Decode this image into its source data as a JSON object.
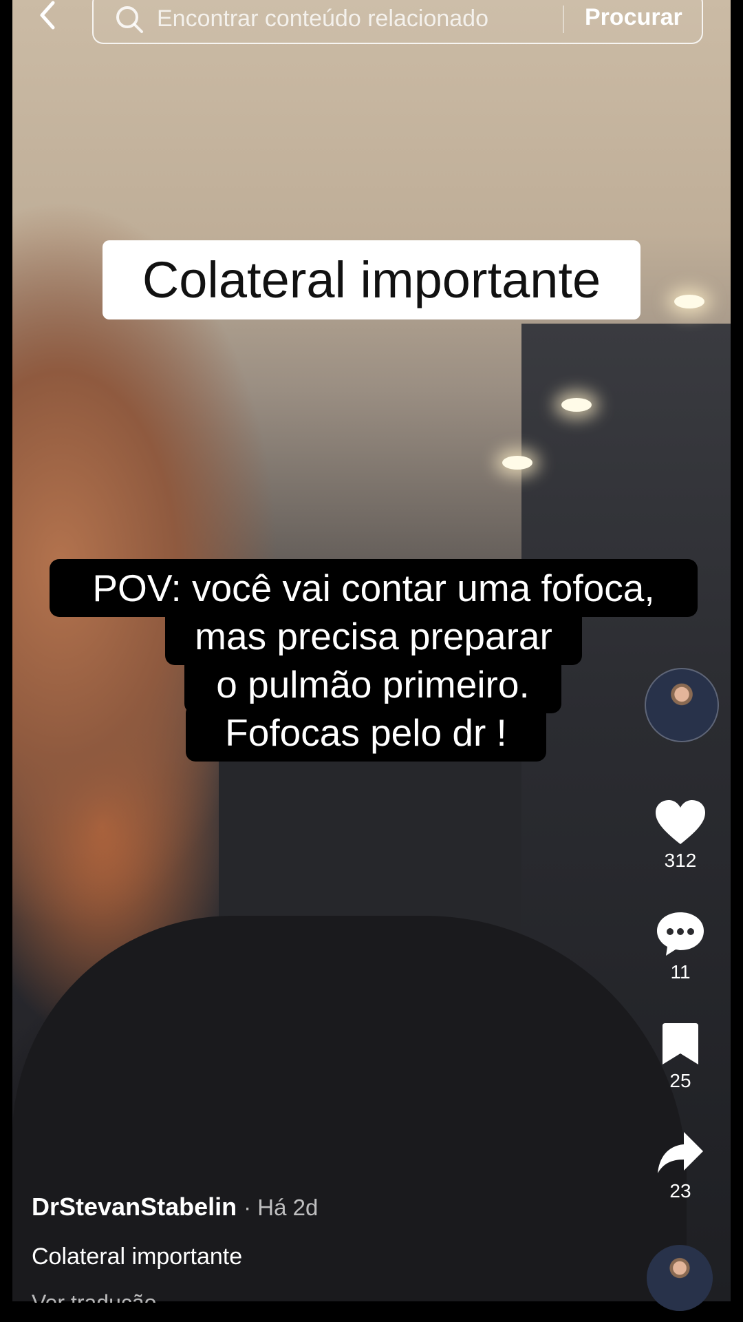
{
  "search": {
    "placeholder": "Encontrar conteúdo relacionado",
    "submit_label": "Procurar"
  },
  "video": {
    "title_card": "Colateral importante",
    "caption_lines": [
      "POV: você vai contar uma fofoca,",
      "mas precisa preparar",
      "o pulmão primeiro.",
      "Fofocas pelo dr !"
    ]
  },
  "actions": {
    "likes": "312",
    "comments": "11",
    "saves": "25",
    "shares": "23"
  },
  "post": {
    "author": "DrStevanStabelin",
    "time": "· Há 2d",
    "description": "Colateral importante",
    "translate_label": "Ver tradução"
  },
  "icons": [
    "back-icon",
    "search-icon",
    "heart-icon",
    "comment-icon",
    "bookmark-icon",
    "share-icon"
  ],
  "colors": {
    "accent": "#ffffff",
    "caption_bg": "#000000"
  }
}
